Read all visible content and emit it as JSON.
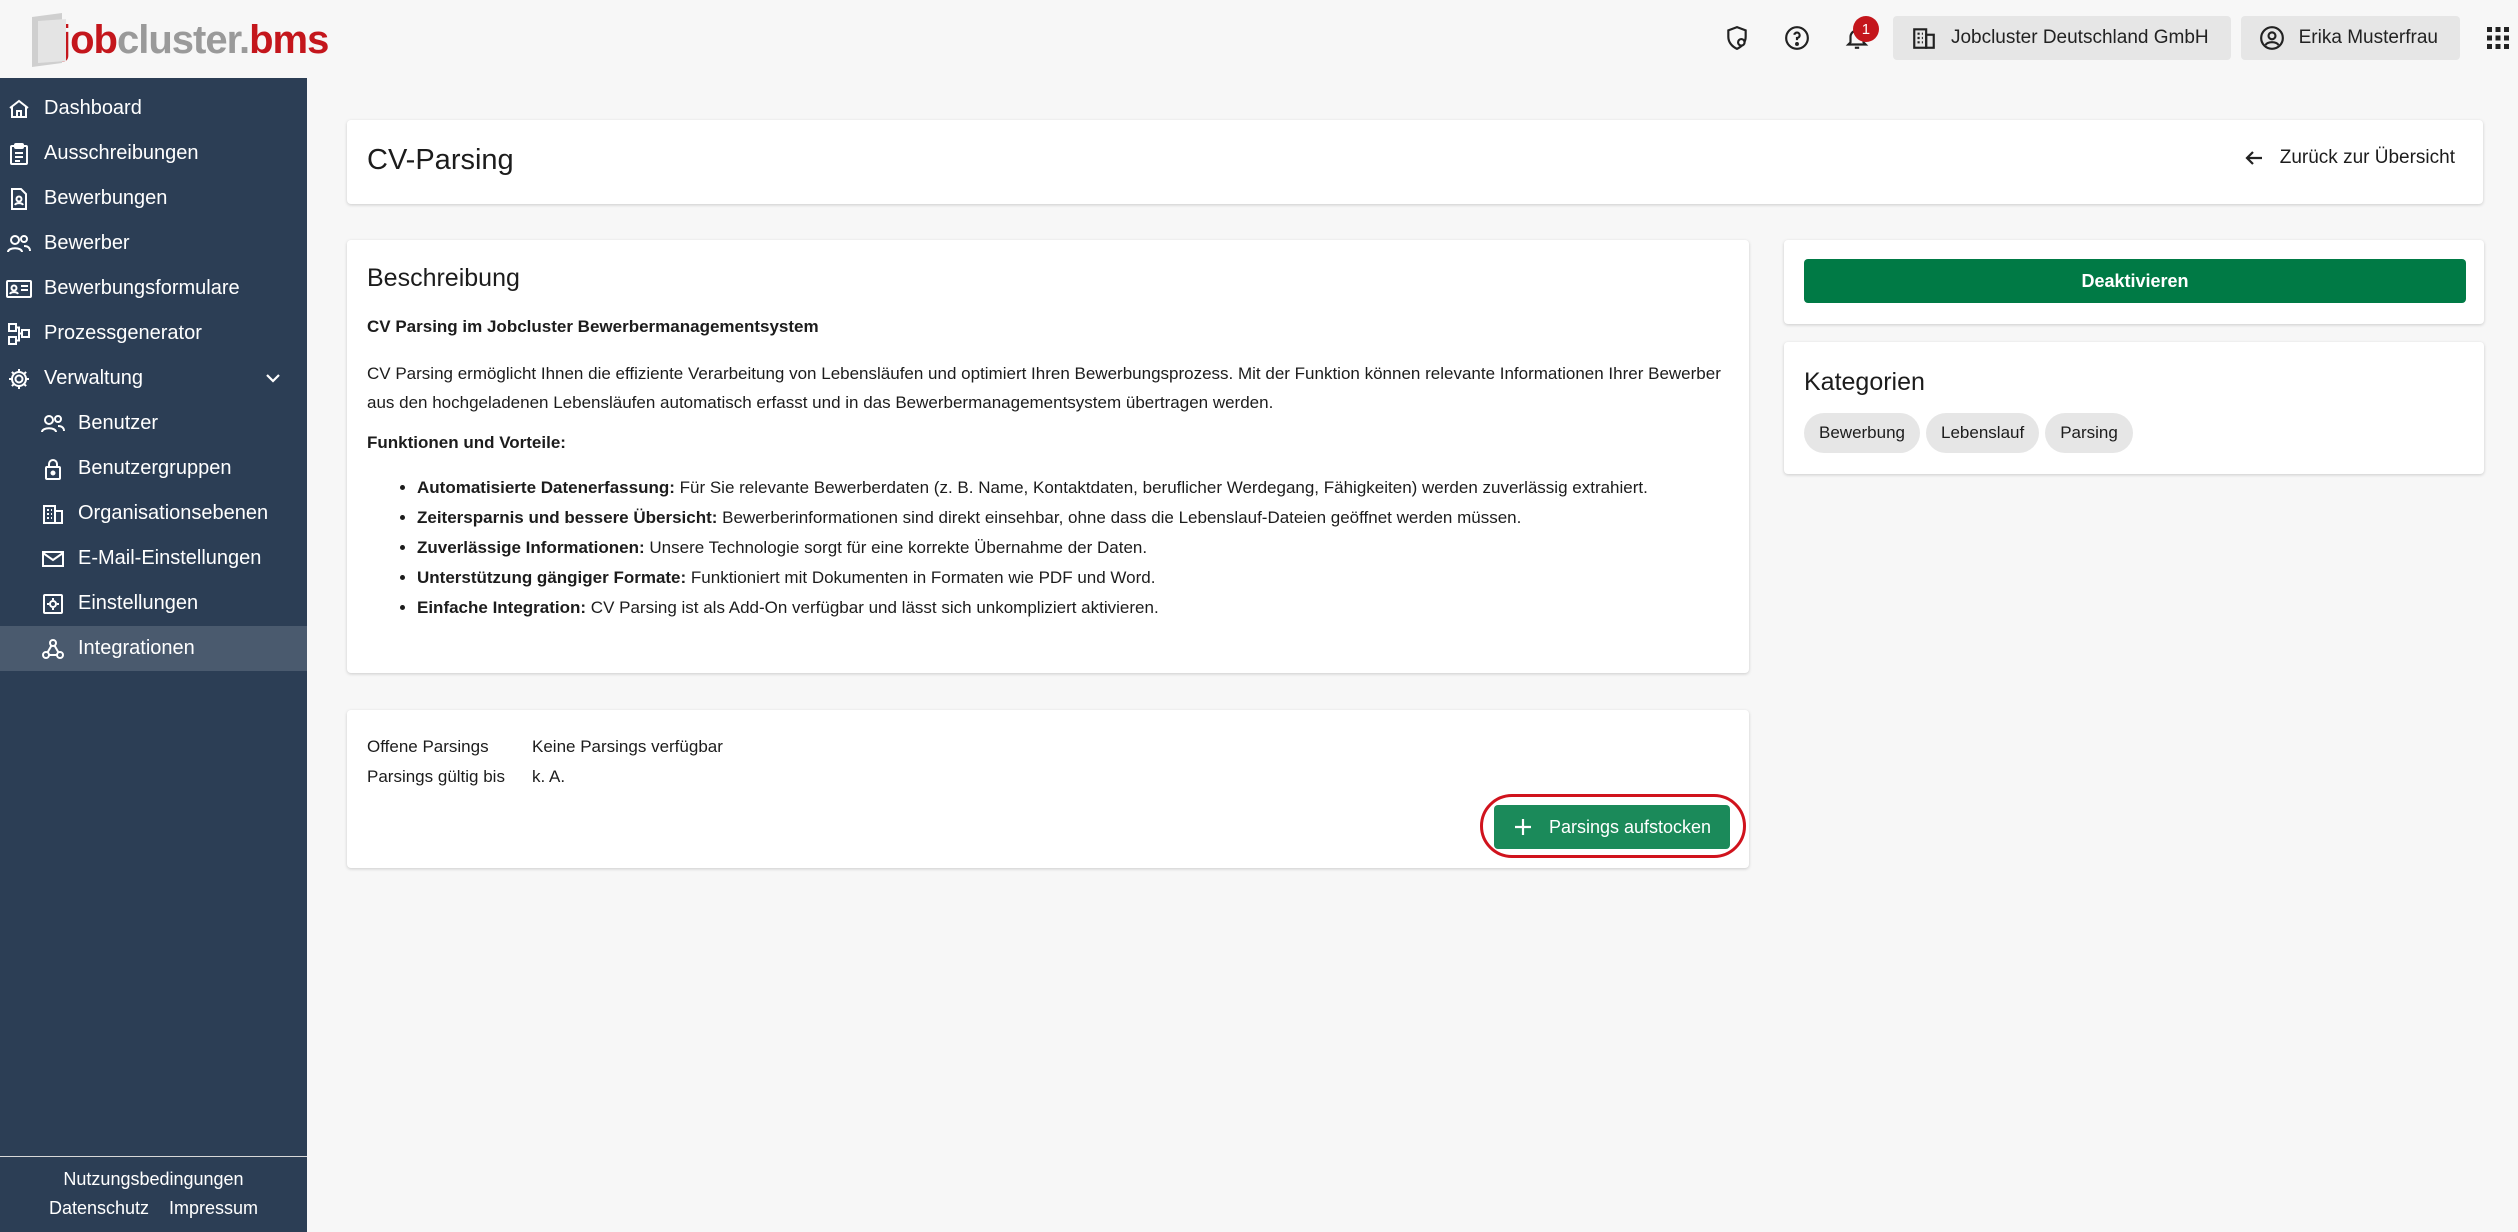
{
  "header": {
    "logo_job": "job",
    "logo_cluster": "cluster",
    "logo_dot": ".",
    "logo_bms": "bms",
    "notification_count": "1",
    "company": "Jobcluster Deutschland GmbH",
    "user": "Erika Musterfrau"
  },
  "sidebar": {
    "items": [
      {
        "label": "Dashboard",
        "icon": "home-icon"
      },
      {
        "label": "Ausschreibungen",
        "icon": "clipboard-icon"
      },
      {
        "label": "Bewerbungen",
        "icon": "document-user-icon"
      },
      {
        "label": "Bewerber",
        "icon": "users-icon"
      },
      {
        "label": "Bewerbungsformulare",
        "icon": "id-card-icon"
      },
      {
        "label": "Prozessgenerator",
        "icon": "flow-icon"
      },
      {
        "label": "Verwaltung",
        "icon": "gear-icon"
      }
    ],
    "sub_items": [
      {
        "label": "Benutzer",
        "icon": "users-icon"
      },
      {
        "label": "Benutzergruppen",
        "icon": "lock-icon"
      },
      {
        "label": "Organisationsebenen",
        "icon": "building-icon"
      },
      {
        "label": "E-Mail-Einstellungen",
        "icon": "mail-icon"
      },
      {
        "label": "Einstellungen",
        "icon": "settings-box-icon"
      },
      {
        "label": "Integrationen",
        "icon": "webhook-icon"
      }
    ],
    "footer": {
      "terms": "Nutzungsbedingungen",
      "privacy": "Datenschutz",
      "imprint": "Impressum"
    }
  },
  "page": {
    "title": "CV-Parsing",
    "back_label": "Zurück zur Übersicht"
  },
  "description": {
    "heading": "Beschreibung",
    "subtitle": "CV Parsing im Jobcluster Bewerbermanagementsystem",
    "paragraph": "CV Parsing ermöglicht Ihnen die effiziente Verarbeitung von Lebensläufen und optimiert Ihren Bewerbungsprozess. Mit der Funktion können relevante Informationen Ihrer Bewerber aus den hochgeladenen Lebensläufen automatisch erfasst und in das Bewerbermanagementsystem übertragen werden.",
    "features_title": "Funktionen und Vorteile:",
    "features": [
      {
        "bold": "Automatisierte Datenerfassung:",
        "text": " Für Sie relevante Bewerberdaten (z. B. Name, Kontaktdaten, beruflicher Werdegang, Fähigkeiten) werden zuverlässig extrahiert."
      },
      {
        "bold": "Zeitersparnis und bessere Übersicht:",
        "text": " Bewerberinformationen sind direkt einsehbar, ohne dass die Lebenslauf-Dateien geöffnet werden müssen."
      },
      {
        "bold": "Zuverlässige Informationen:",
        "text": " Unsere Technologie sorgt für eine korrekte Übernahme der Daten."
      },
      {
        "bold": "Unterstützung gängiger Formate:",
        "text": " Funktioniert mit Dokumenten in Formaten wie PDF und Word."
      },
      {
        "bold": "Einfache Integration:",
        "text": " CV Parsing ist als Add-On verfügbar und lässt sich unkompliziert aktivieren."
      }
    ]
  },
  "parsings": {
    "open_label": "Offene Parsings",
    "open_value": "Keine Parsings verfügbar",
    "valid_label": "Parsings gültig bis",
    "valid_value": "k. A.",
    "add_button": "Parsings aufstocken"
  },
  "actions": {
    "deactivate": "Deaktivieren"
  },
  "categories": {
    "heading": "Kategorien",
    "chips": [
      "Bewerbung",
      "Lebenslauf",
      "Parsing"
    ]
  },
  "colors": {
    "sidebar_bg": "#2c3e55",
    "primary_green": "#007a45",
    "add_green": "#1b8a5a",
    "brand_red": "#c4161c",
    "highlight_red": "#d0131d"
  }
}
